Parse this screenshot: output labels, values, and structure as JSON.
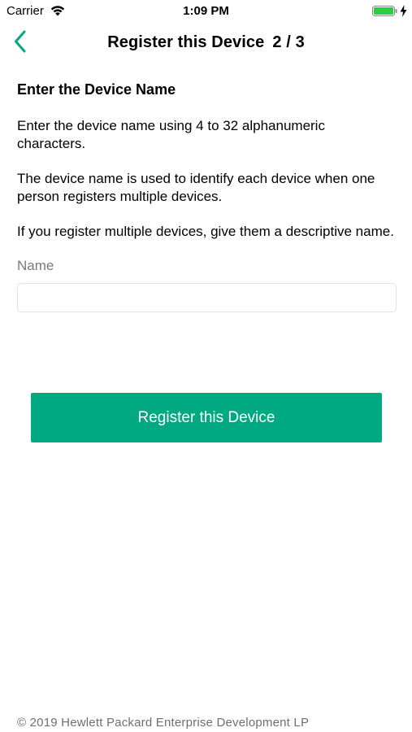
{
  "status_bar": {
    "carrier": "Carrier",
    "time": "1:09 PM",
    "battery_level": 1.0,
    "battery_color": "#2ecc40",
    "wifi_icon": "wifi-icon",
    "charging_icon": "bolt-icon"
  },
  "nav": {
    "back_icon": "chevron-left-icon",
    "title": "Register this Device",
    "step": "2 / 3",
    "accent_color": "#01a982"
  },
  "content": {
    "section_title": "Enter the Device Name",
    "paragraphs": [
      "Enter the device name using 4 to 32 alphanumeric characters.",
      "The device name is used to identify each device when one person registers multiple devices.",
      "If you register multiple devices, give them a descriptive name."
    ],
    "name_label": "Name",
    "name_value": "",
    "name_placeholder": ""
  },
  "register_button": {
    "label": "Register this Device",
    "color": "#01a982"
  },
  "footer": {
    "copyright": "© 2019 Hewlett Packard Enterprise Development LP"
  }
}
